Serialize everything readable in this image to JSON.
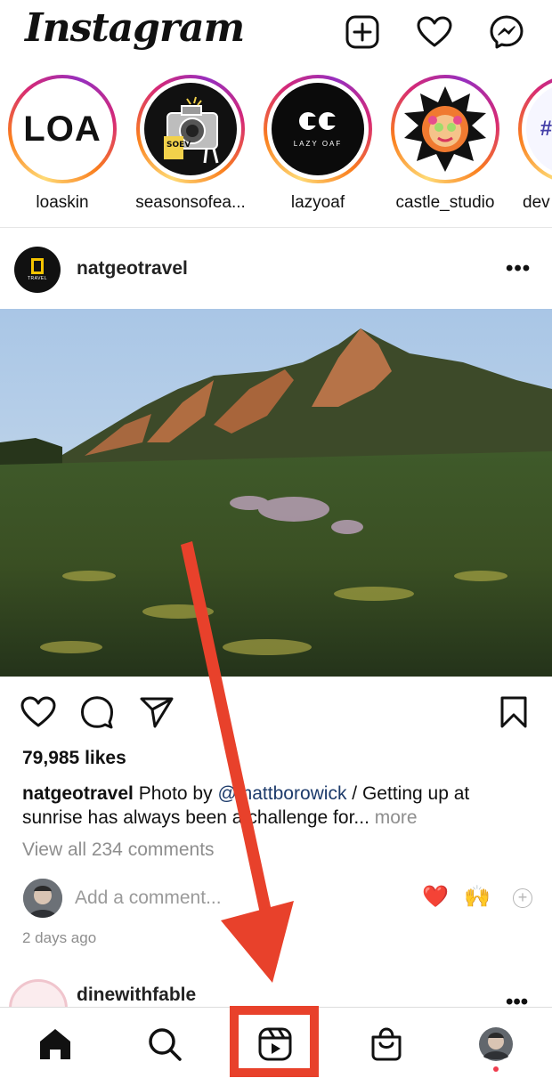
{
  "app": {
    "logo_text": "Instagram"
  },
  "header": {
    "icons": [
      "new-post-icon",
      "activity-heart-icon",
      "messenger-icon"
    ]
  },
  "stories": [
    {
      "username": "loaskin",
      "avatar_text": "LOA"
    },
    {
      "username": "seasonsofea...",
      "avatar_text": "SOEV"
    },
    {
      "username": "lazyoaf",
      "avatar_text": "LAZY OAF"
    },
    {
      "username": "castle_studio",
      "avatar_text": ""
    },
    {
      "username": "dev",
      "avatar_text": ""
    }
  ],
  "post": {
    "username": "natgeotravel",
    "avatar_text": "TRAVEL",
    "likes": "79,985 likes",
    "caption_user": "natgeotravel",
    "caption_pre": " Photo by ",
    "caption_mention": "@mattborowick",
    "caption_post": " / Getting up at sunrise has always been a challenge for... ",
    "caption_more": "more",
    "view_comments": "View all 234 comments",
    "comment_placeholder": "Add a comment...",
    "quick_reactions": [
      "❤️",
      "🙌"
    ],
    "timestamp": "2 days ago"
  },
  "next_post": {
    "username": "dinewithfable"
  },
  "tabbar": {
    "items": [
      "home-icon",
      "search-icon",
      "reels-icon",
      "shop-icon",
      "profile-avatar"
    ],
    "highlighted": "reels-icon"
  },
  "colors": {
    "annotation_red": "#e8412b",
    "mention_blue": "#1d3b6b",
    "muted_gray": "#8e8e8e",
    "notification_red": "#ef3b4c"
  }
}
